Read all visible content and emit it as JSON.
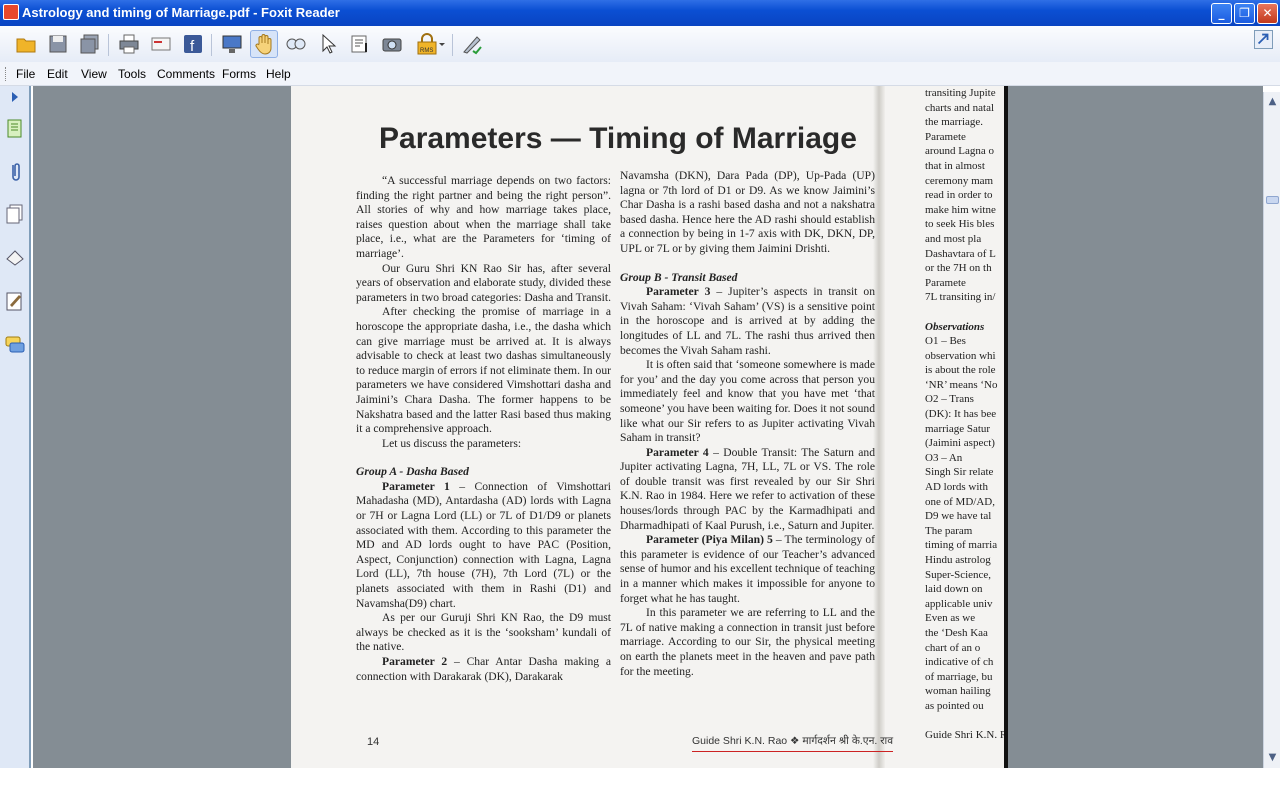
{
  "window": {
    "title": "Astrology and timing of Marriage.pdf - Foxit Reader",
    "minimize": "_",
    "maximize": "❐",
    "close": "✕"
  },
  "menu": [
    "File",
    "Edit",
    "View",
    "Tools",
    "Comments",
    "Forms",
    "Help"
  ],
  "toolbar": {
    "icons": [
      "open-folder-icon",
      "save-icon",
      "save-all-icon",
      "print-icon",
      "email-icon",
      "facebook-icon",
      "fullscreen-icon",
      "hand-tool-icon",
      "zoom-loupe-icon",
      "select-cursor-icon",
      "text-select-icon",
      "snapshot-icon",
      "rms-lock-icon",
      "sign-icon"
    ],
    "active": "hand-tool-icon"
  },
  "nav_panel": [
    "pages-icon",
    "attachments-icon",
    "layers-icon",
    "bookmarks-icon",
    "signatures-icon",
    "comments-icon"
  ],
  "page": {
    "title": "Parameters — Timing of Marriage",
    "col1": [
      {
        "t": "“A successful marriage depends on two factors: finding the right partner and being the right person”. All stories of why and how marriage takes place, raises question about when the marriage shall take place, i.e., what are the Parameters for ‘timing of marriage’.",
        "cls": "ind"
      },
      {
        "t": "Our Guru Shri KN Rao Sir has, after several years of observation and elaborate study, divided these parameters in two broad categories: Dasha and Transit.",
        "cls": "ind"
      },
      {
        "t": "After checking the promise of marriage in a horoscope the appropriate dasha, i.e., the dasha which can give marriage must be arrived at. It is always advisable to check at least two dashas simultaneously to reduce margin of errors if not eliminate them. In our parameters we have considered Vimshottari dasha and Jaimini’s Chara Dasha. The former happens to be Nakshatra based and the latter Rasi based thus making it a comprehensive approach.",
        "cls": "ind"
      },
      {
        "t": "Let us discuss the parameters:",
        "cls": "ind"
      },
      {
        "t": "Group A - Dasha Based",
        "cls": "grp"
      },
      {
        "b": "Parameter 1",
        "t": " – Connection of Vimshottari Mahadasha (MD), Antardasha (AD) lords with Lagna or 7H or Lagna Lord (LL) or 7L of D1/D9 or planets associated with them. According to this parameter the MD and AD lords ought to have PAC (Position, Aspect, Conjunction) connection with Lagna, Lagna Lord (LL), 7th house (7H), 7th Lord (7L) or the planets associated with them in Rashi (D1) and Navamsha(D9) chart.",
        "cls": "ind"
      },
      {
        "t": "As per our Guruji Shri KN Rao, the D9 must always be checked as it is the ‘sooksham’ kundali of the native.",
        "cls": "ind"
      },
      {
        "b": "Parameter 2",
        "t": " – Char Antar Dasha making a connection with Darakarak (DK), Darakarak",
        "cls": "ind"
      }
    ],
    "col2": [
      {
        "t": "Navamsha (DKN), Dara Pada (DP), Up-Pada (UP) lagna or 7th lord of D1 or D9. As we know Jaimini’s Char Dasha is a rashi based dasha and not a nakshatra based dasha. Hence here the AD rashi should establish a connection by being in 1-7 axis with DK, DKN, DP, UPL or 7L or by giving them Jaimini Drishti.",
        "cls": ""
      },
      {
        "t": "Group B - Transit Based",
        "cls": "grp"
      },
      {
        "b": "Parameter 3",
        "t": " – Jupiter’s aspects in transit on Vivah Saham: ‘Vivah Saham’ (VS) is a sensitive point in the horoscope and is arrived at by adding the longitudes of LL and 7L. The rashi thus arrived then becomes the Vivah Saham rashi.",
        "cls": "ind"
      },
      {
        "t": "It is often said that ‘someone somewhere is made for you’ and the day you come across that person you immediately feel and know that you have met ‘that someone’ you have been waiting for. Does it not sound like what our Sir refers to as Jupiter activating Vivah Saham in transit?",
        "cls": "ind"
      },
      {
        "b": "Parameter 4",
        "t": " – Double Transit: The Saturn and Jupiter activating Lagna, 7H, LL, 7L or VS. The role of double transit was first revealed by our Sir Shri K.N. Rao in 1984. Here we refer to activation of these houses/lords through PAC by the Karmadhipati and Dharmadhipati of Kaal Purush, i.e., Saturn and Jupiter.",
        "cls": "ind"
      },
      {
        "b": "Parameter (Piya Milan) 5",
        "t": " – The terminology of this parameter is evidence of our Teacher’s advanced sense of humor and his excellent technique of teaching in a manner which makes it impossible for anyone to forget what he has taught.",
        "cls": "ind"
      },
      {
        "t": "In this parameter we are referring to LL and the 7L of native making a connection in transit just before marriage. According to our Sir, the physical meeting on earth the planets meet in the heaven and pave path for the meeting.",
        "cls": "ind"
      }
    ],
    "page_number": "14",
    "footer": "Guide Shri K.N. Rao ❖ मार्गदर्शन श्री के.एन. राव",
    "col3": [
      "transiting Jupite",
      "charts and natal",
      "the marriage.",
      "    Paramete",
      "around Lagna o",
      "that in almost",
      "ceremony mam",
      "read in order to",
      "make him witne",
      "to seek His bles",
      "and most pla",
      "Dashavtara of L",
      "or the 7H on th",
      "    Paramete",
      "7L transiting in/",
      "",
      "Observations",
      "    O1 – Bes",
      "observation whi",
      "is about the role",
      "‘NR’ means ‘No",
      "    O2 – Trans",
      "(DK): It has bee",
      "marriage Satur",
      "(Jaimini aspect)",
      "    O3 – An",
      "Singh Sir relate",
      "AD lords with",
      "one of MD/AD,",
      "D9 we have tal",
      "    The param",
      "timing of marria",
      "Hindu astrolog",
      "Super-Science,",
      "laid down on",
      "applicable univ",
      "    Even as we",
      "the ‘Desh Kaa",
      "chart of an o",
      "indicative of ch",
      "of marriage, bu",
      "woman hailing",
      "as pointed ou",
      "",
      "Guide Shri K.N. R"
    ]
  }
}
